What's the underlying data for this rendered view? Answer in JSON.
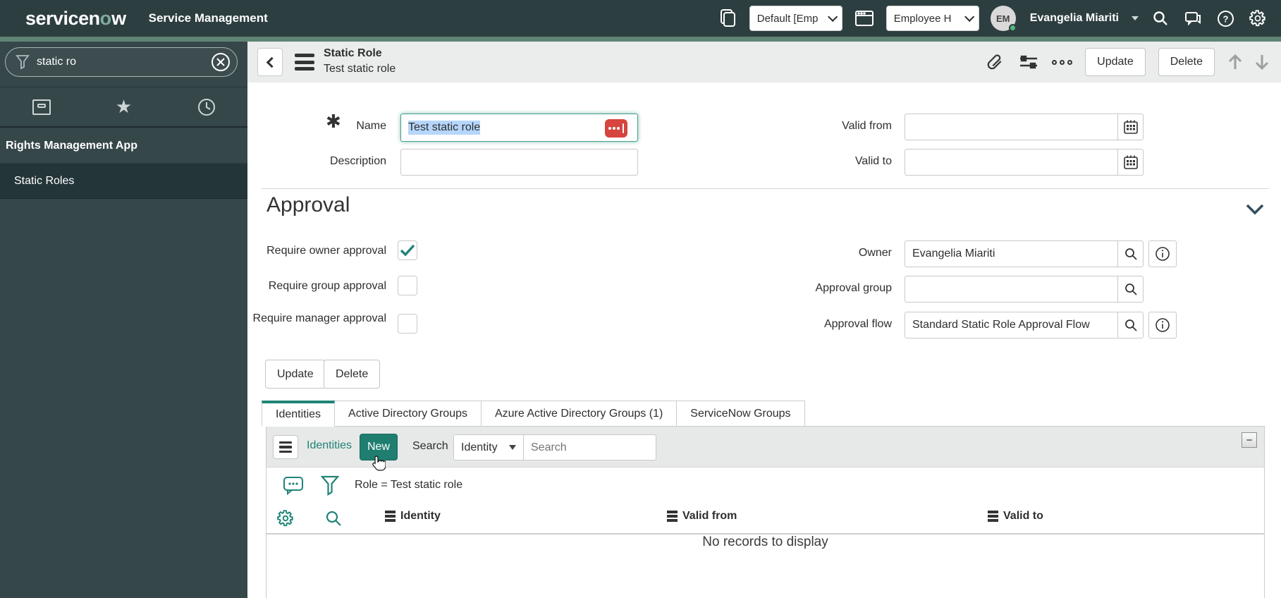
{
  "header": {
    "logo_left": "servicen",
    "logo_o": "o",
    "logo_right": "w",
    "product": "Service Management",
    "update_set": {
      "value": "Default [Emp"
    },
    "app_picker": {
      "value": "Employee H"
    },
    "user": {
      "initials": "EM",
      "name": "Evangelia Miariti"
    }
  },
  "sidebar": {
    "filter_value": "static ro",
    "section_label": "Rights Management App",
    "items": [
      {
        "label": "Static Roles"
      }
    ]
  },
  "record_header": {
    "title": "Static Role",
    "subtitle": "Test static role",
    "update_label": "Update",
    "delete_label": "Delete"
  },
  "form": {
    "name": {
      "label": "Name",
      "value": "Test static role"
    },
    "description": {
      "label": "Description",
      "value": ""
    },
    "valid_from": {
      "label": "Valid from",
      "value": ""
    },
    "valid_to": {
      "label": "Valid to",
      "value": ""
    },
    "approval": {
      "heading": "Approval",
      "require_owner": {
        "label": "Require owner approval",
        "checked": true
      },
      "require_group": {
        "label": "Require group approval",
        "checked": false
      },
      "require_manager": {
        "label": "Require manager approval",
        "checked": false
      },
      "owner": {
        "label": "Owner",
        "value": "Evangelia Miariti"
      },
      "approval_group": {
        "label": "Approval group",
        "value": ""
      },
      "approval_flow": {
        "label": "Approval flow",
        "value": "Standard Static Role Approval Flow"
      }
    },
    "update_label": "Update",
    "delete_label": "Delete"
  },
  "tabs": [
    {
      "label": "Identities"
    },
    {
      "label": "Active Directory Groups"
    },
    {
      "label": "Azure Active Directory Groups (1)"
    },
    {
      "label": "ServiceNow Groups"
    }
  ],
  "list": {
    "title": "Identities",
    "new_label": "New",
    "search_label": "Search",
    "search_column": "Identity",
    "search_placeholder": "Search",
    "filter_text": "Role = Test static role",
    "columns": [
      {
        "label": "Identity"
      },
      {
        "label": "Valid from"
      },
      {
        "label": "Valid to"
      }
    ],
    "empty_text": "No records to display"
  },
  "colors": {
    "header_bg": "#2d3e40",
    "stripe": "#5f8575",
    "accent_teal": "#1f8476",
    "selection_blue": "#b6d6fb",
    "password_icon_red": "#d6453e"
  }
}
